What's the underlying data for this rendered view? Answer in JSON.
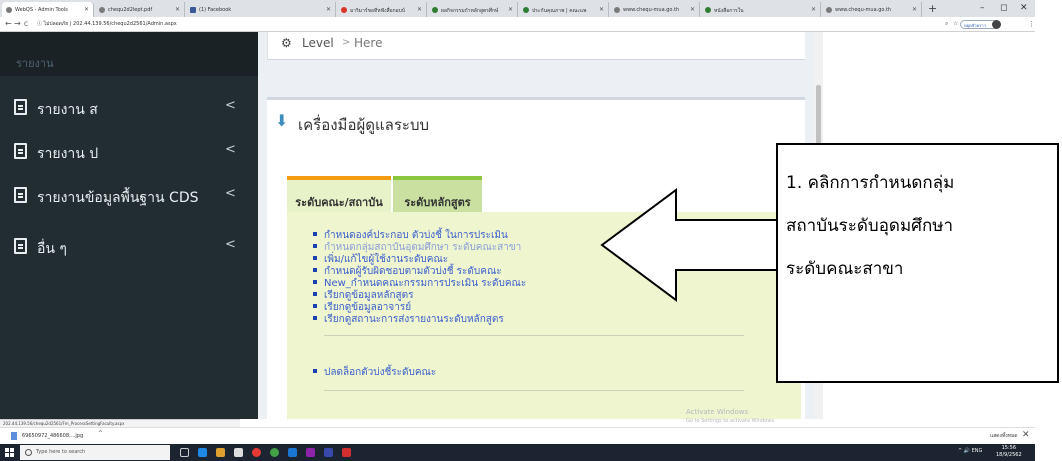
{
  "browser": {
    "tabs": [
      {
        "title": "WebQS - Admin Tools"
      },
      {
        "title": "chequ2d2lept.pdf"
      },
      {
        "title": "(1) Facebook"
      },
      {
        "title": "มาริมาร์ขอทีหฟังสื่อกอบบ์"
      },
      {
        "title": "ผลกิจกรรมกำหลักสูตรศึกษ์"
      },
      {
        "title": "ประกันคุณภาพ | คณะแพ"
      },
      {
        "title": "www.chequ-mua.go.th"
      },
      {
        "title": "หนังสือการใน"
      },
      {
        "title": "www.chequ-mua.go.th"
      }
    ],
    "new_tab_label": "+",
    "window_controls": {
      "minimize": "–",
      "maximize": "◻",
      "close": "✕"
    },
    "nav": {
      "back": "←",
      "forward": "→",
      "reload": "C",
      "info": "ⓘ"
    },
    "url_prefix": "ไม่ปลอดภัย",
    "url": "202.44.139.56/chequ2d2561/Admin.aspx",
    "profile_label": "หยุดชั่วคราว"
  },
  "sidebar": {
    "header": "รายงาน",
    "items": [
      {
        "label": "รายงาน ส",
        "chevron": "<"
      },
      {
        "label": "รายงาน ป",
        "chevron": "<"
      },
      {
        "label": "รายงานข้อมูลพื้นฐาน CDS",
        "chevron": "<"
      },
      {
        "label": "อื่น ๆ",
        "chevron": "<"
      }
    ]
  },
  "breadcrumb": {
    "icon": "dashboard-icon",
    "level": "Level",
    "separator": ">",
    "here": "Here"
  },
  "main": {
    "title": "เครื่องมือผู้ดูแลระบบ",
    "tabs": [
      {
        "label": "ระดับคณะ/สถาบัน",
        "accent": "#f39c12"
      },
      {
        "label": "ระดับหลักสูตร",
        "accent": "#8cc63f"
      }
    ],
    "links": [
      "กำหนดองค์ประกอบ ตัวบ่งชี้ ในการประเมิน",
      "กำหนดกลุ่มสถาบันอุดมศึกษา ระดับคณะสาขา",
      "เพิ่ม/แก้ไขผู้ใช้งานระดับคณะ",
      "กำหนดผู้รับผิดชอบตามตัวบ่งชี้ ระดับคณะ",
      "New_กำหนดคณะกรรมการประเมิน ระดับคณะ",
      "เรียกดูข้อมูลหลักสูตร",
      "เรียกดูข้อมูลอาจารย์",
      "เรียกดูสถานะการส่งรายงานระดับหลักสูตร"
    ],
    "unlock_link": "ปลดล็อกตัวบ่งชี้ระดับคณะ"
  },
  "watermark": {
    "line1": "Activate Windows",
    "line2": "Go to Settings to activate Windows."
  },
  "status_url": "202.44.139.56/chequ2d2561/Fm_ProcessSettingFaculty.aspx",
  "download_bar": {
    "file": "69650972_486608....jpg",
    "chevron": "^",
    "show_all": "แสดงทั้งหมด",
    "close": "✕"
  },
  "taskbar": {
    "search_placeholder": "Type here to search",
    "tray": "^ 🔊 ENG",
    "time": "15:56",
    "date": "18/9/2562"
  },
  "callout": {
    "line1": "1. คลิกการกำหนดกลุ่ม",
    "line2": "สถาบันระดับอุดมศึกษา",
    "line3": "ระดับคณะสาขา"
  }
}
